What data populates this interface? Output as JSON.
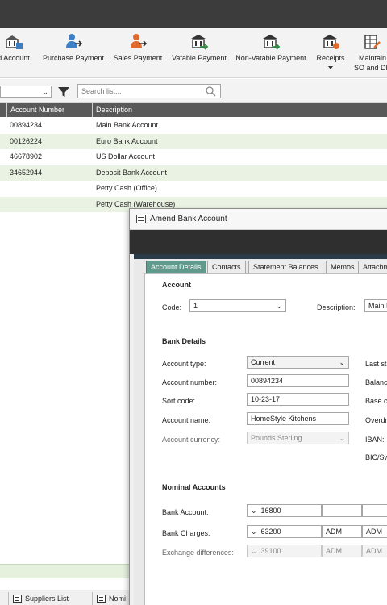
{
  "toolbar": {
    "items": [
      {
        "label": "d Account",
        "icon": "bank-account-icon"
      },
      {
        "label": "Purchase Payment",
        "icon": "purchase-payment-icon"
      },
      {
        "label": "Sales Payment",
        "icon": "sales-payment-icon"
      },
      {
        "label": "Vatable Payment",
        "icon": "vatable-payment-icon"
      },
      {
        "label": "Non-Vatable Payment",
        "icon": "non-vatable-payment-icon"
      },
      {
        "label": "Receipts",
        "icon": "receipts-icon"
      },
      {
        "label": "Maintain",
        "label2": "SO and DD",
        "icon": "maintain-icon"
      }
    ]
  },
  "filter": {
    "search_placeholder": "Search list..."
  },
  "grid": {
    "columns": [
      "Account Number",
      "Description"
    ],
    "rows": [
      {
        "number": "00894234",
        "description": "Main Bank Account"
      },
      {
        "number": "00126224",
        "description": "Euro Bank Account"
      },
      {
        "number": "46678902",
        "description": "US Dollar Account"
      },
      {
        "number": "34652944",
        "description": "Deposit Bank Account"
      },
      {
        "number": "",
        "description": "Petty Cash (Office)"
      },
      {
        "number": "",
        "description": "Petty Cash (Warehouse)"
      }
    ]
  },
  "bottom_tabs": [
    "Suppliers List",
    "Nomi"
  ],
  "dialog": {
    "title": "Amend Bank Account",
    "tabs": [
      "Account Details",
      "Contacts",
      "Statement Balances",
      "Memos",
      "Attachm"
    ],
    "account": {
      "heading": "Account",
      "code_label": "Code:",
      "code_value": "1",
      "description_label": "Description:",
      "description_value": "Main Ba"
    },
    "bank_details": {
      "heading": "Bank Details",
      "account_type_label": "Account type:",
      "account_type_value": "Current",
      "account_number_label": "Account number:",
      "account_number_value": "00894234",
      "sort_code_label": "Sort code:",
      "sort_code_value": "10-23-17",
      "account_name_label": "Account name:",
      "account_name_value": "HomeStyle Kitchens",
      "currency_label": "Account currency:",
      "currency_value": "Pounds Sterling",
      "right_labels": [
        "Last st",
        "Balanc",
        "Base c",
        "Overdr",
        "IBAN:",
        "BIC/Sw"
      ]
    },
    "nominal": {
      "heading": "Nominal Accounts",
      "bank_account_label": "Bank Account:",
      "bank_account_code": "16800",
      "bank_charges_label": "Bank Charges:",
      "bank_charges_code": "63200",
      "bank_charges_dept1": "ADM",
      "bank_charges_dept2": "ADM",
      "exchange_label": "Exchange differences:",
      "exchange_code": "39100",
      "exchange_dept1": "ADM",
      "exchange_dept2": "ADM"
    }
  }
}
